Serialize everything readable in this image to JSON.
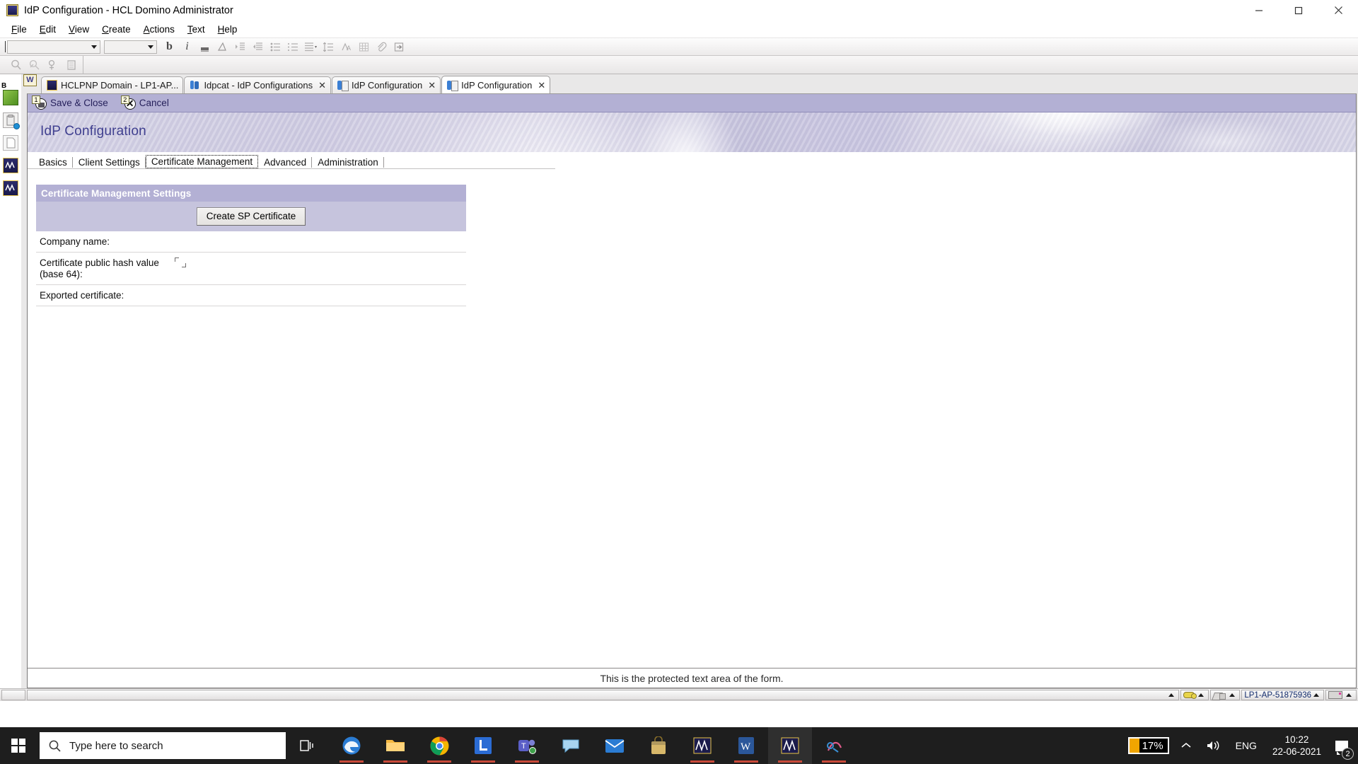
{
  "window": {
    "title": "IdP Configuration - HCL Domino Administrator",
    "app_icon": "domino-app-icon",
    "controls": {
      "minimize": "minimize-icon",
      "maximize": "maximize-icon",
      "close": "close-icon"
    }
  },
  "menubar": {
    "items": [
      {
        "label": "File",
        "accel": "F"
      },
      {
        "label": "Edit",
        "accel": "E"
      },
      {
        "label": "View",
        "accel": "V"
      },
      {
        "label": "Create",
        "accel": "C"
      },
      {
        "label": "Actions",
        "accel": "A"
      },
      {
        "label": "Text",
        "accel": "T"
      },
      {
        "label": "Help",
        "accel": "H"
      }
    ]
  },
  "toolbar": {
    "font_combo_value": "",
    "size_combo_value": "",
    "buttons": [
      {
        "name": "bold-button",
        "glyph": "b"
      },
      {
        "name": "italic-button",
        "glyph": "i"
      },
      {
        "name": "text-highlight-button",
        "glyph": "▬"
      },
      {
        "name": "text-color-button",
        "glyph": "◺"
      },
      {
        "name": "indent-button",
        "glyph": "⇥"
      },
      {
        "name": "outdent-button",
        "glyph": "⇤"
      },
      {
        "name": "bullet-list-button",
        "glyph": "☰"
      },
      {
        "name": "numbered-list-button",
        "glyph": "≔"
      },
      {
        "name": "paragraph-align-button",
        "glyph": "▤"
      },
      {
        "name": "line-spacing-button",
        "glyph": "↕"
      },
      {
        "name": "permanent-pen-button",
        "glyph": "🖉"
      },
      {
        "name": "insert-table-button",
        "glyph": "▦"
      },
      {
        "name": "attach-file-button",
        "glyph": "📎"
      },
      {
        "name": "insert-link-button",
        "glyph": "⇥"
      }
    ]
  },
  "toolbar2": {
    "buttons": [
      {
        "name": "search-button",
        "glyph": "🔍"
      },
      {
        "name": "search-next-button",
        "glyph": "🔎"
      },
      {
        "name": "add-recipient-button",
        "glyph": "☊"
      },
      {
        "name": "address-book-button",
        "glyph": "▤"
      }
    ]
  },
  "rail": {
    "pin_label": "W",
    "badge_label": "B",
    "items": [
      {
        "name": "rail-item-workspace",
        "label": ""
      },
      {
        "name": "rail-item-clipboard",
        "label": ""
      },
      {
        "name": "rail-item-page",
        "label": ""
      },
      {
        "name": "rail-item-domino-1",
        "label": ""
      },
      {
        "name": "rail-item-domino-2",
        "label": ""
      }
    ]
  },
  "window_tabs": [
    {
      "label": "HCLPNP Domain - LP1-AP...",
      "icon": "domino-server-icon",
      "closable": false,
      "active": false
    },
    {
      "label": "Idpcat - IdP Configurations",
      "icon": "people-view-icon",
      "closable": true,
      "close_label": "✕",
      "active": false
    },
    {
      "label": "IdP Configuration",
      "icon": "document-icon",
      "closable": true,
      "close_label": "✕",
      "active": false
    },
    {
      "label": "IdP Configuration",
      "icon": "document-icon",
      "closable": true,
      "close_label": "✕",
      "active": true
    }
  ],
  "action_bar": {
    "actions": [
      {
        "label": "Save & Close",
        "number": "1",
        "icon": "save-and-close-icon"
      },
      {
        "label": "Cancel",
        "number": "2",
        "icon": "cancel-icon"
      }
    ]
  },
  "banner": {
    "title": "IdP Configuration"
  },
  "form_tabs": [
    {
      "label": "Basics",
      "focused": false
    },
    {
      "label": "Client Settings",
      "focused": false
    },
    {
      "label": "Certificate Management",
      "focused": true
    },
    {
      "label": "Advanced",
      "focused": false
    },
    {
      "label": "Administration",
      "focused": false
    }
  ],
  "section": {
    "heading": "Certificate Management Settings",
    "create_button_label": "Create SP Certificate"
  },
  "fields": [
    {
      "label": "Company name:",
      "value": "",
      "has_rich_text_marker": false
    },
    {
      "label": "Certificate public hash value\n(base 64):",
      "value": "",
      "has_rich_text_marker": true
    },
    {
      "label": "Exported certificate:",
      "value": "",
      "has_rich_text_marker": false
    }
  ],
  "protected_note": "This is the protected text area of the form.",
  "status_bar": {
    "left_cell": "",
    "message": "",
    "cells": [
      {
        "name": "status-key-cell",
        "icon": "key-icon",
        "label": ""
      },
      {
        "name": "status-security-cell",
        "icon": "lock-icon",
        "label": ""
      },
      {
        "name": "status-server-cell",
        "icon": "",
        "label": "LP1-AP-51875936"
      },
      {
        "name": "status-keyboard-cell",
        "icon": "keyboard-icon",
        "label": ""
      }
    ]
  },
  "taskbar": {
    "start_label": "start-button",
    "search_placeholder": "Type here to search",
    "task_view_label": "task-view-button",
    "apps": [
      {
        "name": "taskbar-edge",
        "glyph": "edge-icon",
        "running": true
      },
      {
        "name": "taskbar-file-explorer",
        "glyph": "folder-icon",
        "running": true
      },
      {
        "name": "taskbar-chrome",
        "glyph": "chrome-icon",
        "running": true
      },
      {
        "name": "taskbar-lotus",
        "glyph": "lotus-icon",
        "running": true
      },
      {
        "name": "taskbar-teams",
        "glyph": "teams-icon",
        "running": true
      },
      {
        "name": "taskbar-sametime",
        "glyph": "sametime-icon",
        "running": false
      },
      {
        "name": "taskbar-mail",
        "glyph": "mail-icon",
        "running": false
      },
      {
        "name": "taskbar-store",
        "glyph": "store-icon",
        "running": false
      },
      {
        "name": "taskbar-notes-designer",
        "glyph": "designer-icon",
        "running": true
      },
      {
        "name": "taskbar-word",
        "glyph": "word-icon",
        "running": true
      },
      {
        "name": "taskbar-domino-admin",
        "glyph": "domino-admin-icon",
        "running": true
      },
      {
        "name": "taskbar-sametime-connect",
        "glyph": "connect-icon",
        "running": true
      }
    ],
    "tray": {
      "battery_percent": "17%",
      "show_hidden_label": "⌃",
      "volume_label": "volume-icon",
      "language": "ENG",
      "time": "10:22",
      "date": "22-06-2021",
      "notification_count": "2"
    }
  }
}
